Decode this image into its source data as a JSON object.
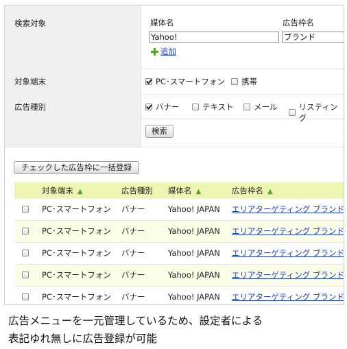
{
  "form": {
    "search_target_label": "検索対象",
    "media_name_label": "媒体名",
    "media_name_value": "Yahoo!",
    "ad_slot_label": "広告枠名",
    "ad_slot_value": "ブランド",
    "add_link": "追加",
    "device_label": "対象端末",
    "device_options": [
      {
        "label": "PC･スマートフォン",
        "checked": true
      },
      {
        "label": "携帯",
        "checked": false
      }
    ],
    "ad_type_label": "広告種別",
    "ad_type_options": [
      {
        "label": "バナー",
        "checked": true
      },
      {
        "label": "テキスト",
        "checked": false
      },
      {
        "label": "メール",
        "checked": false
      },
      {
        "label": "リスティング",
        "checked": false
      }
    ],
    "search_button": "検索"
  },
  "bulk_register_button": "チェックした広告枠に一括登録",
  "table": {
    "columns": [
      "対象端末",
      "広告種別",
      "媒体名",
      "広告枠名"
    ],
    "sort_icon": "▲",
    "rows": [
      {
        "device": "PC･スマートフォン",
        "type": "バナー",
        "media": "Yahoo! JAPAN",
        "slot": "エリアターゲティング ブランドパネル"
      },
      {
        "device": "PC･スマートフォン",
        "type": "バナー",
        "media": "Yahoo! JAPAN",
        "slot": "エリアターゲティング ブランドパネル"
      },
      {
        "device": "PC･スマートフォン",
        "type": "バナー",
        "media": "Yahoo! JAPAN",
        "slot": "エリアターゲティング ブランドパネル"
      },
      {
        "device": "PC･スマートフォン",
        "type": "バナー",
        "media": "Yahoo! JAPAN",
        "slot": "エリアターゲティング ブランドパネル"
      },
      {
        "device": "PC･スマートフォン",
        "type": "バナー",
        "media": "Yahoo! JAPAN",
        "slot": "エリアターゲティング ブランドパネル"
      }
    ]
  },
  "caption": {
    "line1": "広告メニューを一元管理しているため、設定者による",
    "line2": "表記ゆれ無しに広告登録が可能"
  }
}
